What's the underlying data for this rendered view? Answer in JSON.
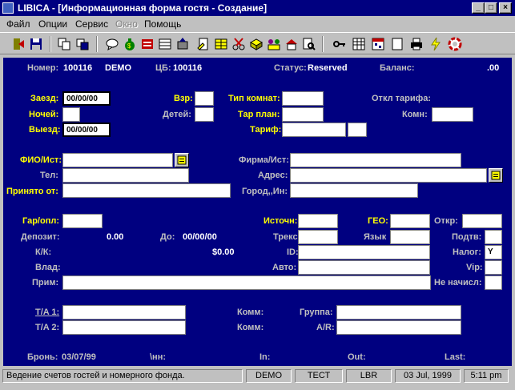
{
  "window": {
    "title": "LIBICA - [Информационная форма гостя - Создание]",
    "buttons": {
      "minimize": "_",
      "maximize": "□",
      "close": "×"
    }
  },
  "menu": {
    "items": [
      "Файл",
      "Опции",
      "Сервис",
      "Окно",
      "Помощь"
    ]
  },
  "toolbar": {
    "icons": [
      "exit-icon",
      "save-icon",
      "copy-icon",
      "copy-alt-icon",
      "chat-icon",
      "money-bag-icon",
      "reservation-icon",
      "room-icon",
      "key-card-icon",
      "document-icon",
      "grid-icon",
      "scissors-icon",
      "box-icon",
      "groups-icon",
      "house-icon",
      "search-document-icon",
      "key-icon",
      "table-icon",
      "calendar-icon",
      "blank-icon",
      "printer-icon",
      "lightning-icon",
      "lifebuoy-icon"
    ]
  },
  "form": {
    "header": {
      "number_label": "Номер:",
      "number_value": "100116",
      "demo": "DEMO",
      "cb_label": "ЦБ:",
      "cb_value": "100116",
      "status_label": "Статус:",
      "status_value": "Reserved",
      "balance_label": "Баланс:",
      "balance_value": ".00"
    },
    "stay": {
      "arrival_label": "Заезд:",
      "arrival_value": "00/00/00",
      "nights_label": "Ночей:",
      "departure_label": "Выезд:",
      "departure_value": "00/00/00",
      "adults_label": "Взр:",
      "children_label": "Детей:",
      "room_type_label": "Тип комнат:",
      "rate_plan_label": "Тар план:",
      "tariff_label": "Тариф:",
      "tariff_off_label": "Откл тарифа:",
      "room_label": "Комн:"
    },
    "guest": {
      "fio_label": "ФИО/Ист:",
      "phone_label": "Тел:",
      "accepted_by_label": "Принято от:",
      "company_label": "Фирма/Ист:",
      "address_label": "Адрес:",
      "city_label": "Город,,Ин:"
    },
    "payment": {
      "guarantee_label": "Гар/опл:",
      "source_label": "Источн:",
      "geo_label": "ГЕО:",
      "open_label": "Откр:",
      "deposit_label": "Депозит:",
      "deposit_value": "0.00",
      "until_label": "До:",
      "until_value": "00/00/00",
      "treks_label": "Трекс",
      "language_label": "Язык",
      "subtv_label": "Подтв:",
      "cc_label": "К/К:",
      "cc_amount": "$0.00",
      "id_label": "ID:",
      "tax_label": "Налог:",
      "tax_value": "Y",
      "owner_label": "Влад:",
      "auto_label": "Авто:",
      "vip_label": "Vip:",
      "note_label": "Прим:",
      "not_charged_label": "Не начисл:"
    },
    "agents": {
      "ta1_label": "T/A 1:",
      "ta2_label": "T/A 2:",
      "comm1_label": "Комм:",
      "comm2_label": "Комм:",
      "group_label": "Группа:",
      "ar_label": "A/R:"
    },
    "footer": {
      "booking_label": "Бронь:",
      "booking_value": "03/07/99",
      "nn_label": "\\нн:",
      "in_label": "In:",
      "out_label": "Out:",
      "last_label": "Last:"
    }
  },
  "statusbar": {
    "message": "Ведение счетов гостей и номерного фонда.",
    "db": "DEMO",
    "mode": "ТЕСТ",
    "code": "LBR",
    "date": "03 Jul, 1999",
    "time": "5:11 pm"
  }
}
